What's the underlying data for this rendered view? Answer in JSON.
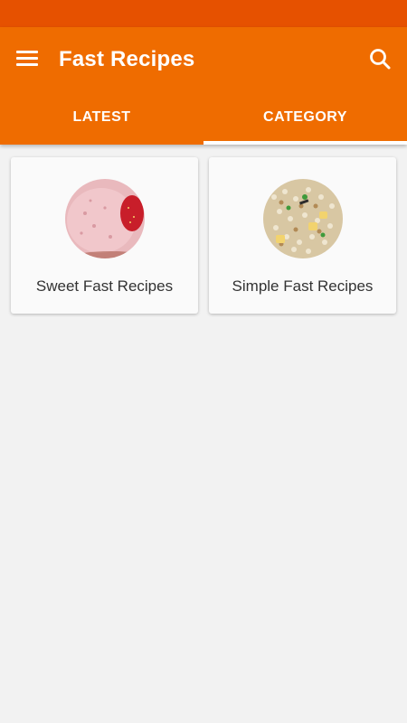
{
  "app": {
    "title": "Fast Recipes"
  },
  "tabs": [
    {
      "label": "LATEST",
      "selected": false
    },
    {
      "label": "CATEGORY",
      "selected": true
    }
  ],
  "categories": [
    {
      "label": "Sweet Fast Recipes",
      "image": "pink-smoothie-with-strawberry"
    },
    {
      "label": "Simple Fast Recipes",
      "image": "sabudana-khichdi-with-peas"
    }
  ],
  "icons": {
    "menu": "menu-icon",
    "search": "search-icon"
  },
  "colors": {
    "status_bar": "#e65100",
    "app_bar": "#ef6c00",
    "background": "#f2f2f2",
    "card": "#fafafa"
  }
}
